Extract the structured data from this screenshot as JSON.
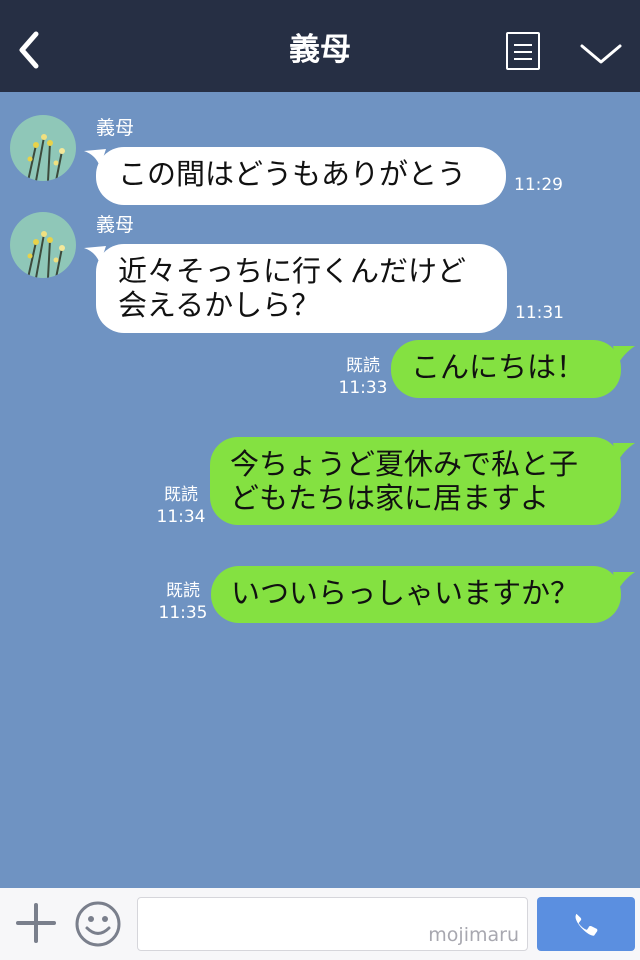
{
  "header": {
    "title": "義母"
  },
  "messages": [
    {
      "side": "in",
      "sender": "義母",
      "lines": [
        "この間はどうもありがとう"
      ],
      "time": "11:29"
    },
    {
      "side": "in",
      "sender": "義母",
      "lines": [
        "近々そっちに行くんだけど",
        "会えるかしら？"
      ],
      "time": "11:31"
    },
    {
      "side": "out",
      "read": "既読",
      "lines": [
        "こんにちは！"
      ],
      "time": "11:33"
    },
    {
      "side": "out",
      "read": "既読",
      "lines": [
        "今ちょうど夏休みで私と子",
        "どもたちは家に居ますよ"
      ],
      "time": "11:34"
    },
    {
      "side": "out",
      "read": "既読",
      "lines": [
        "いついらっしゃいますか？"
      ],
      "time": "11:35"
    }
  ],
  "footer": {
    "watermark": "mojimaru"
  },
  "icons": {
    "back": "chevron-left-icon",
    "menu": "list-icon",
    "collapse": "chevron-down-icon",
    "add": "plus-icon",
    "emoji": "smiley-icon",
    "call": "phone-icon"
  },
  "colors": {
    "header_bg": "#262f44",
    "chat_bg": "#6f93c2",
    "outgoing_bubble": "#84e141",
    "incoming_bubble": "#ffffff",
    "call_button": "#5b8fe0"
  }
}
